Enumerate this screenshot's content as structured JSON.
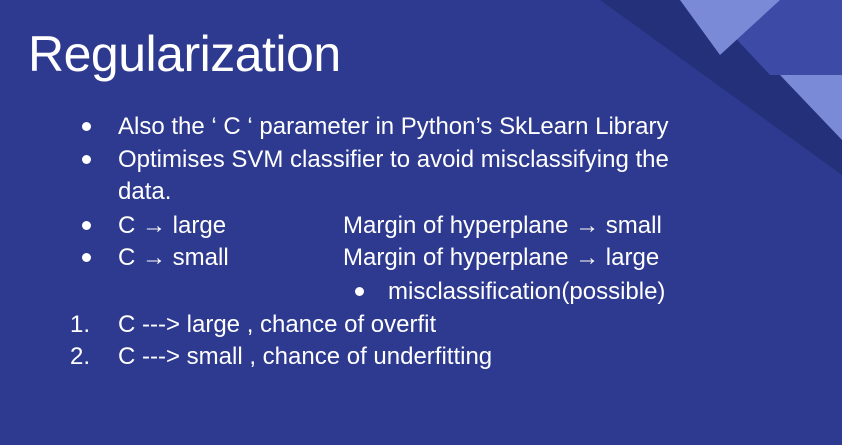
{
  "colors": {
    "background": "#2e3a8f",
    "text": "#ffffff",
    "accent_dark": "#1f2a6f",
    "accent_mid": "#3f4aa8",
    "accent_light": "#7b8ad6"
  },
  "slide": {
    "title": "Regularization",
    "bullets": [
      {
        "text": "Also the ‘ C ‘ parameter in Python’s SkLearn Library"
      },
      {
        "text": "Optimises SVM classifier to avoid misclassifying the",
        "continuation": "data."
      },
      {
        "left": "C → large",
        "right": "Margin of hyperplane → small"
      },
      {
        "left": "C → small",
        "right": "Margin of hyperplane → large"
      }
    ],
    "sub_bullet": "misclassification(possible)",
    "numbered": [
      {
        "marker": "1.",
        "text": "C ---> large , chance of overfit"
      },
      {
        "marker": "2.",
        "text": "C ---> small , chance of underfitting"
      }
    ]
  }
}
